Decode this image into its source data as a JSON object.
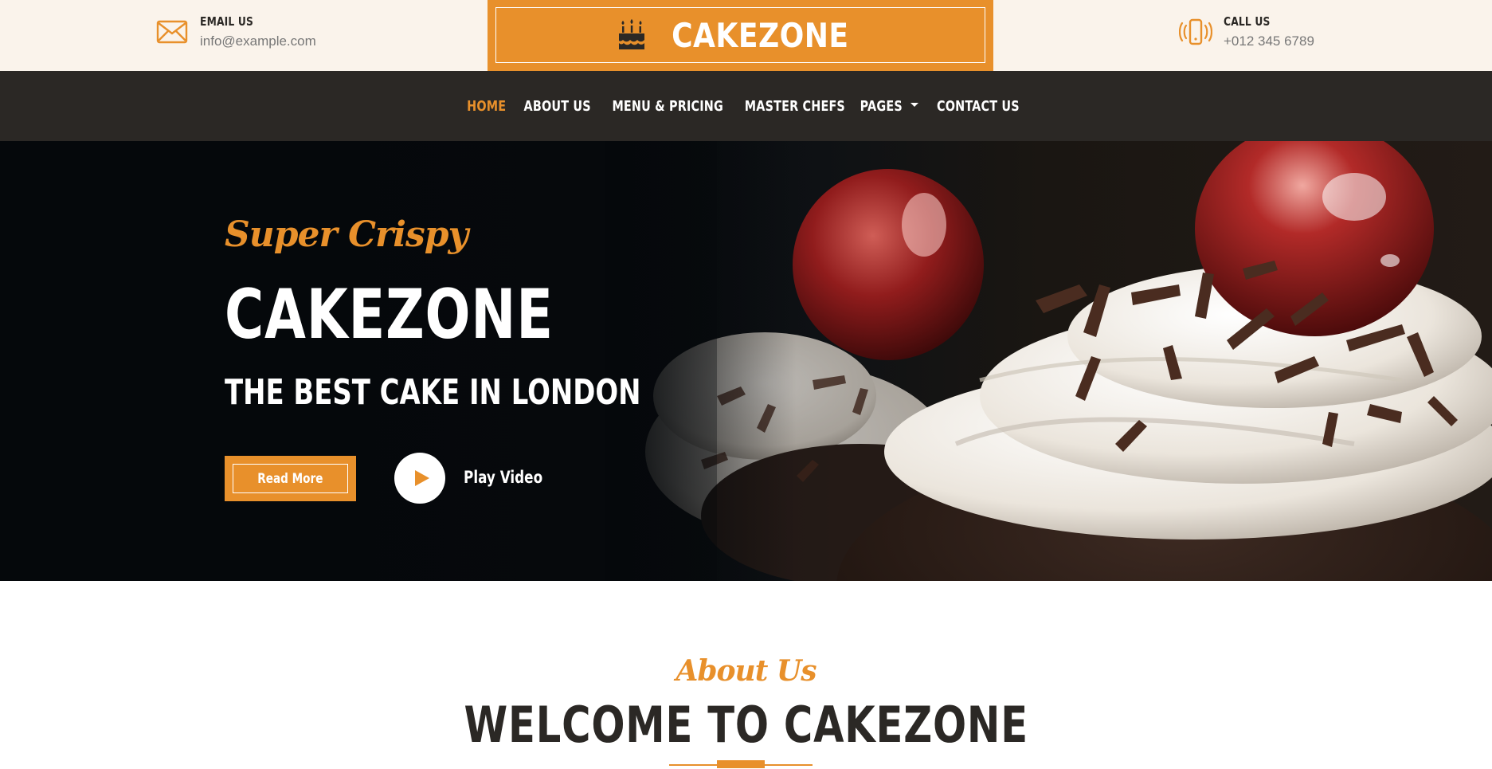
{
  "topbar": {
    "email": {
      "label": "EMAIL US",
      "value": "info@example.com",
      "icon": "envelope-icon"
    },
    "phone": {
      "label": "CALL US",
      "value": "+012 345 6789",
      "icon": "phone-vibrate-icon"
    },
    "brand": {
      "name": "CAKEZONE",
      "icon": "birthday-cake-icon"
    }
  },
  "nav": {
    "items": [
      {
        "label": "HOME",
        "active": true
      },
      {
        "label": "ABOUT US",
        "active": false
      },
      {
        "label": "MENU & PRICING",
        "active": false
      },
      {
        "label": "MASTER CHEFS",
        "active": false
      },
      {
        "label": "PAGES",
        "active": false,
        "dropdown": true
      },
      {
        "label": "CONTACT US",
        "active": false
      }
    ]
  },
  "hero": {
    "eyebrow": "Super Crispy",
    "title": "CAKEZONE",
    "subtitle": "THE BEST CAKE IN LONDON",
    "read_more": "Read More",
    "play_video": "Play Video",
    "play_icon": "play-icon"
  },
  "about": {
    "eyebrow": "About Us",
    "heading": "WELCOME TO CAKEZONE"
  },
  "colors": {
    "accent": "#E8902B",
    "dark": "#2B2825",
    "topbar_bg": "#FAF3EB"
  }
}
